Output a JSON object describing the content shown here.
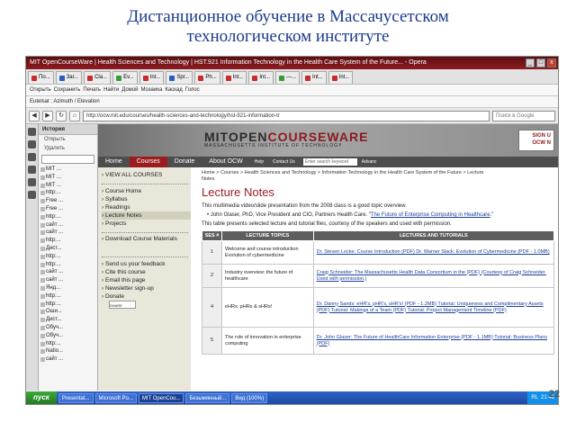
{
  "slide": {
    "title_line1": "Дистанционное обучение в Массачусетском",
    "title_line2": "технологическом институте",
    "slide_number": "22"
  },
  "window": {
    "title": "MIT OpenCourseWare | Health Sciences and Technology | HST.921 Information Technology in the Health Care System of the Future... - Opera",
    "min": "_",
    "max": "□",
    "close": "x"
  },
  "tabs": [
    "По...",
    "Заг...",
    "Cla...",
    "Ev...",
    "Int...",
    "Spr...",
    "Ph...",
    "Int...",
    "Int...",
    "—...",
    "Int...",
    "Int..."
  ],
  "bookmarks": [
    "Открыть",
    "Сохранить",
    "Печать",
    "Найти",
    "Домой",
    "Мозаика",
    "Каскад",
    "Голос"
  ],
  "breadcrumb_bar": "Eutelsat : Azimuth / Elevation",
  "address": {
    "url": "http://ocw.mit.edu/courses/health-sciences-and-technology/hst-921-information-tr",
    "search_placeholder": "Поиск в Google"
  },
  "history": {
    "heading": "История",
    "open": "Открыть",
    "delete": "Удалить",
    "items": [
      "MIT ...",
      "MIT ...",
      "MIT ...",
      "http:...",
      "Free ...",
      "Free ...",
      "http:...",
      "сайт ...",
      "сайт ...",
      "http:...",
      "Дист...",
      "http:...",
      "http:...",
      "сайт ...",
      "сайт ...",
      "Янд...",
      "http:...",
      "http:...",
      "Оши...",
      "Дист...",
      "Обуч...",
      "Обуч...",
      "http:...",
      "Natio...",
      "сайт ..."
    ]
  },
  "mit": {
    "logo_main": "MITOPEN",
    "logo_accent": "COURSEWARE",
    "logo_sub": "MASSACHUSETTS INSTITUTE OF TECHNOLOGY",
    "signup_line1": "SIGN U",
    "signup_line2": "OCW N",
    "nav": [
      "Home",
      "Courses",
      "Donate",
      "About OCW"
    ],
    "nav_small": [
      "Help",
      "Contact Us",
      "Information Technology in the Health Care System of the Future"
    ],
    "keyword": "Enter search keyword",
    "advanced": "Advanc"
  },
  "sidebar": {
    "view_all": "VIEW ALL COURSES",
    "links1": [
      "Course Home",
      "Syllabus",
      "Readings",
      "Lecture Notes",
      "Projects"
    ],
    "links2": [
      "Download Course Materials"
    ],
    "links3": [
      "Send us your feedback",
      "Cite this course",
      "Email this page",
      "Newsletter sign-up",
      "Donate"
    ],
    "share": "SHARE"
  },
  "main": {
    "breadcrumb": "Home > Courses > Health Sciences and Technology > Information Technology in the Health Care System of the Future > Lecture Notes",
    "heading": "Lecture Notes",
    "intro": "This multimedia video/slide presentation from the 2008 class is a good topic overview.",
    "bullet_text": "John Glaser, PhD, Vice President and CIO, Partners Health Care. \"",
    "bullet_link": "The Future of Enterprise Computing in Healthcare",
    "bullet_end": ".\"",
    "table_intro": "This table presents selected lecture and tutorial files, courtesy of the speakers and used with permission.",
    "columns": [
      "SES #",
      "LECTURE TOPICS",
      "LECTURES AND TUTORIALS"
    ],
    "rows": [
      {
        "ses": "1",
        "topic": "Welcome and course introduction Evolution of cybermedicine",
        "lectures": "Dr. Steven Locke: Course Introduction (PDF) Dr. Warner Slack: Evolution of Cybermedicine (PDF - 1.0MB)"
      },
      {
        "ses": "2",
        "topic": "Industry overview: the future of healthcare",
        "lectures": "Craig Schneider: The Massachusetts Health Data Consortium in the (PDF) (Courtesy of Craig Schneider. Used with permission.)"
      },
      {
        "ses": "4",
        "topic": "eHRs, pHRs & sHRs!",
        "lectures": "Dr. Danny Sands: eHR's, pHR's, sHR's! (PDF - 1.2MB) Tutorial: Uniqueness and Complimentary Assets (PDF) Tutorial: Makings of a Team (PDF) Tutorial: Project Management Timeline (PDF)"
      },
      {
        "ses": "5",
        "topic": "The role of innovation in enterprise computing",
        "lectures": "Dr. John Glaser: The Future of HealthCare Information Enterprise (PDF - 1.1MB) Tutorial: Business Plans (PDF)"
      }
    ]
  },
  "taskbar": {
    "start": "пуск",
    "buttons": [
      "Presentat...",
      "Microsoft Po...",
      "MIT OpenCou...",
      "Безымянный...",
      "Вид (100%)"
    ],
    "tray": [
      "RL",
      "21:48"
    ]
  }
}
